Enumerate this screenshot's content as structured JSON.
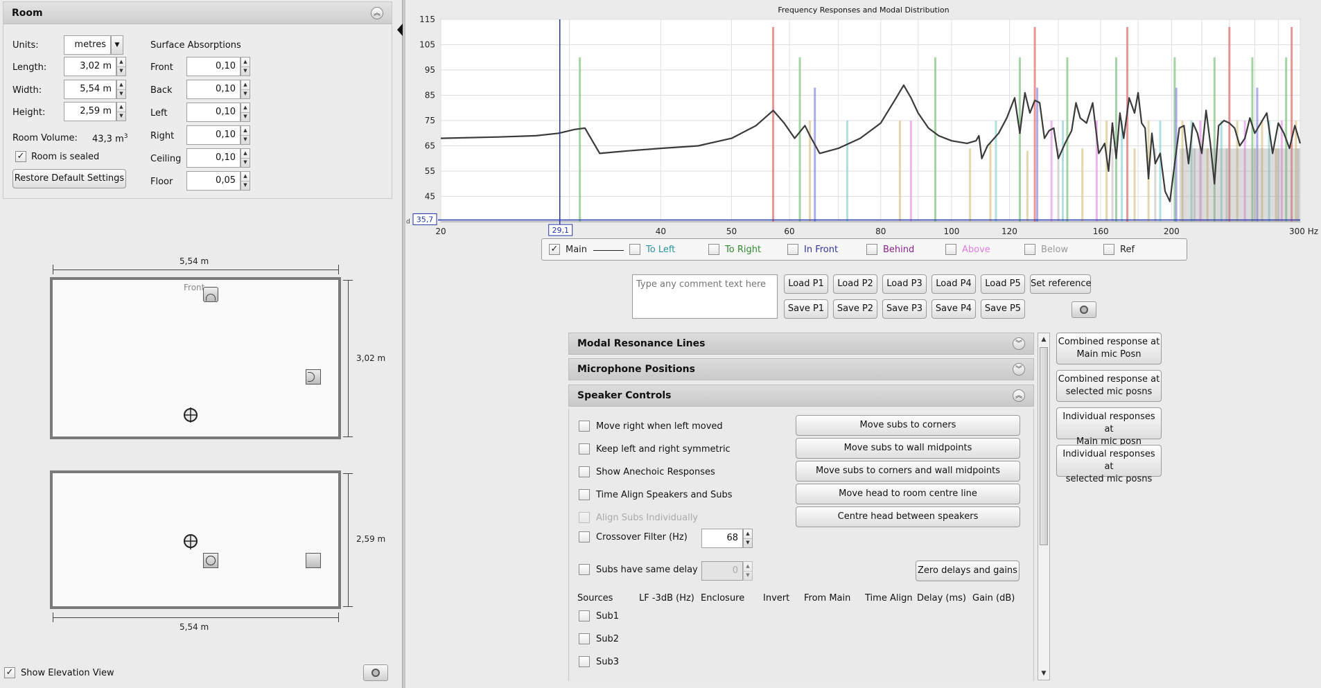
{
  "room": {
    "title": "Room",
    "units_label": "Units:",
    "units_value": "metres",
    "length_label": "Length:",
    "length_value": "3,02 m",
    "width_label": "Width:",
    "width_value": "5,54 m",
    "height_label": "Height:",
    "height_value": "2,59 m",
    "volume_label": "Room Volume:",
    "volume_value": "43,3 m",
    "volume_unit_sup": "3",
    "sealed_label": "Room is sealed",
    "sealed_checked": true,
    "restore_label": "Restore Default Settings",
    "absorptions_title": "Surface Absorptions",
    "absorptions": [
      {
        "label": "Front",
        "value": "0,10"
      },
      {
        "label": "Back",
        "value": "0,10"
      },
      {
        "label": "Left",
        "value": "0,10"
      },
      {
        "label": "Right",
        "value": "0,10"
      },
      {
        "label": "Ceiling",
        "value": "0,10"
      },
      {
        "label": "Floor",
        "value": "0,05"
      }
    ]
  },
  "plan": {
    "top_width_label": "5,54 m",
    "length_label": "3,02 m",
    "front_label": "Front",
    "elev_height_label": "2,59 m",
    "elev_width_label": "5,54 m",
    "show_elevation_label": "Show Elevation View",
    "show_elevation_checked": true
  },
  "chart": {
    "title": "Frequency Responses and Modal Distribution",
    "cursor_y_value": "35,7",
    "cursor_x_value": "29,1",
    "corner_label": "d"
  },
  "chart_data": {
    "type": "line",
    "title": "Frequency Responses and Modal Distribution",
    "x_scale": "log",
    "xlim": [
      20,
      300
    ],
    "ylim": [
      35,
      115
    ],
    "x_ticks": [
      "20",
      "40",
      "50",
      "60",
      "80",
      "100",
      "120",
      "160",
      "200",
      "300 Hz"
    ],
    "x_tick_values": [
      20,
      40,
      50,
      60,
      80,
      100,
      120,
      160,
      200,
      300
    ],
    "y_ticks": [
      115,
      105,
      95,
      85,
      75,
      65,
      55,
      45
    ],
    "grid": true,
    "series": [
      {
        "name": "Main",
        "color": "#3a3a3a",
        "x": [
          20,
          24,
          27,
          29,
          30.5,
          31.5,
          33,
          36,
          40,
          45,
          50,
          54,
          57,
          59,
          61,
          63,
          64,
          66,
          70,
          75,
          80,
          84,
          86,
          88,
          90,
          93,
          96,
          100,
          105,
          108,
          109,
          110,
          112,
          116,
          119,
          122,
          124,
          126,
          128,
          130,
          132,
          134,
          136,
          138,
          140,
          143,
          146,
          148,
          150,
          153,
          156,
          159,
          162,
          164,
          166,
          168,
          170,
          172,
          175,
          178,
          180,
          182,
          184,
          186,
          188,
          190,
          193,
          196,
          199,
          202,
          205,
          208,
          211,
          214,
          217,
          220,
          223,
          226,
          229,
          232,
          236,
          240,
          244,
          248,
          252,
          256,
          260,
          265,
          270,
          275,
          280,
          285,
          290,
          295,
          300
        ],
        "y": [
          68,
          68.5,
          69,
          70,
          71.5,
          72,
          62,
          63,
          64,
          65,
          68,
          73,
          79,
          74,
          68,
          73,
          69,
          62,
          64,
          68,
          74,
          84,
          89,
          84,
          78,
          72,
          69,
          67,
          66,
          67,
          69,
          60,
          65,
          70,
          76,
          84,
          70,
          86,
          78,
          83,
          82,
          68,
          71,
          72,
          60,
          66,
          71,
          82,
          76,
          74,
          82,
          62,
          66,
          55,
          74,
          60,
          78,
          68,
          84,
          78,
          86,
          74,
          72,
          52,
          70,
          58,
          62,
          47,
          43,
          58,
          72,
          73,
          58,
          74,
          70,
          62,
          79,
          66,
          50,
          73,
          75,
          74,
          72,
          65,
          68,
          76,
          70,
          74,
          78,
          62,
          74,
          70,
          64,
          73,
          66
        ]
      },
      {
        "name": "Modal resonance lines (red)",
        "color": "#e06a6a",
        "x": [
          57,
          130,
          174,
          240,
          292
        ],
        "y": [
          112,
          112,
          112,
          112,
          112
        ]
      },
      {
        "name": "Modal resonance lines (green)",
        "color": "#7cc27c",
        "x": [
          31,
          62,
          95,
          124,
          144,
          168,
          202,
          229,
          258,
          287
        ],
        "y": [
          100,
          100,
          100,
          100,
          100,
          100,
          100,
          100,
          100,
          100
        ]
      },
      {
        "name": "Modal resonance lines (blue)",
        "color": "#8a8ae0",
        "x": [
          65,
          131,
          203,
          262
        ],
        "y": [
          88,
          88,
          88,
          88
        ]
      }
    ]
  },
  "legend": {
    "items": [
      {
        "label": "Main",
        "color": "#222222",
        "checked": true,
        "line": true
      },
      {
        "label": "To Left",
        "color": "#2a8fa0",
        "checked": false
      },
      {
        "label": "To Right",
        "color": "#2e8b2e",
        "checked": false
      },
      {
        "label": "In Front",
        "color": "#3030a0",
        "checked": false
      },
      {
        "label": "Behind",
        "color": "#8a208a",
        "checked": false
      },
      {
        "label": "Above",
        "color": "#e07ae0",
        "checked": false
      },
      {
        "label": "Below",
        "color": "#999999",
        "checked": false
      },
      {
        "label": "Ref",
        "color": "#222222",
        "checked": false
      }
    ]
  },
  "presets": {
    "comment_placeholder": "Type any comment text here",
    "load": [
      "Load P1",
      "Load P2",
      "Load P3",
      "Load P4",
      "Load P5"
    ],
    "save": [
      "Save P1",
      "Save P2",
      "Save P3",
      "Save P4",
      "Save P5"
    ],
    "set_reference": "Set reference"
  },
  "sections": {
    "modal": "Modal Resonance Lines",
    "mic": "Microphone Positions",
    "speaker": "Speaker Controls"
  },
  "speaker": {
    "options": [
      {
        "label": "Move right when left moved",
        "disabled": false
      },
      {
        "label": "Keep left and right symmetric",
        "disabled": false
      },
      {
        "label": "Show Anechoic Responses",
        "disabled": false
      },
      {
        "label": "Time Align Speakers and Subs",
        "disabled": false
      },
      {
        "label": "Align Subs Individually",
        "disabled": true
      }
    ],
    "crossover_label": "Crossover Filter (Hz)",
    "crossover_value": "68",
    "subs_delay_label": "Subs have same delay",
    "subs_delay_value": "0",
    "buttons": [
      "Move subs to corners",
      "Move subs to wall midpoints",
      "Move subs to corners and wall midpoints",
      "Move head to room centre line",
      "Centre head between speakers"
    ],
    "zero_button": "Zero delays and gains",
    "table_headers": [
      "Sources",
      "LF -3dB (Hz)",
      "Enclosure",
      "Invert",
      "From Main",
      "Time Align",
      "Delay (ms)",
      "Gain (dB)"
    ],
    "sources": [
      "Sub1",
      "Sub2",
      "Sub3"
    ]
  },
  "right_buttons": [
    {
      "line1": "Combined response at",
      "line2": "Main mic Posn"
    },
    {
      "line1": "Combined response at",
      "line2": "selected mic posns"
    },
    {
      "line1": "Individual responses at",
      "line2": "Main mic posn"
    },
    {
      "line1": "Individual responses at",
      "line2": "selected mic posns"
    }
  ]
}
